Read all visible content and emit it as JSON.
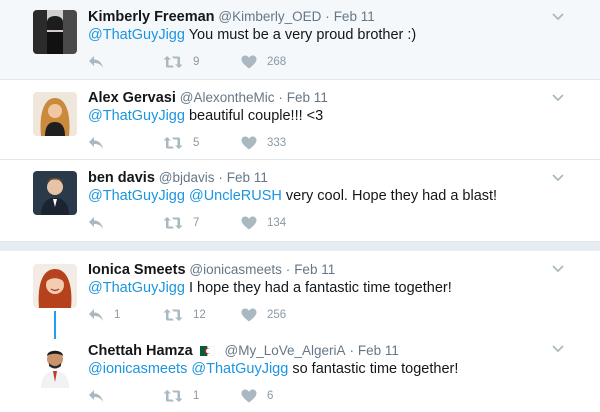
{
  "tweets": [
    {
      "name": "Kimberly Freeman",
      "handle": "@Kimberly_OED",
      "date": "Feb 11",
      "mention": "@ThatGuyJigg",
      "text": " You must be a very proud brother :)",
      "retweets": "9",
      "likes": "268",
      "replies": ""
    },
    {
      "name": "Alex Gervasi",
      "handle": "@AlexontheMic",
      "date": "Feb 11",
      "mention": "@ThatGuyJigg",
      "text": " beautiful couple!!! <3",
      "retweets": "5",
      "likes": "333",
      "replies": ""
    },
    {
      "name": "ben davis",
      "handle": "@bjdavis",
      "date": "Feb 11",
      "mention": "@ThatGuyJigg",
      "mention2": "@UncleRUSH",
      "text": " very cool. Hope they had a blast!",
      "retweets": "7",
      "likes": "134",
      "replies": ""
    },
    {
      "name": "Ionica Smeets",
      "handle": "@ionicasmeets",
      "date": "Feb 11",
      "mention": "@ThatGuyJigg",
      "text": " I hope they had a fantastic time together!",
      "retweets": "12",
      "likes": "256",
      "replies": "1"
    },
    {
      "name": "Chettah Hamza",
      "handle": "@My_LoVe_AlgeriA",
      "date": "Feb 11",
      "mention": "@ionicasmeets",
      "mention2": "@ThatGuyJigg",
      "text": " so fantastic time together!",
      "retweets": "1",
      "likes": "6",
      "replies": ""
    }
  ],
  "separator": "·",
  "icons": {
    "reply": "reply-icon",
    "retweet": "retweet-icon",
    "like": "heart-icon",
    "more": "chevron-down-icon",
    "flag": "algeria-flag-icon"
  },
  "colors": {
    "mention": "#1b95e0",
    "thread_line": "#1da1f2",
    "action_gray": "#8899a6"
  }
}
